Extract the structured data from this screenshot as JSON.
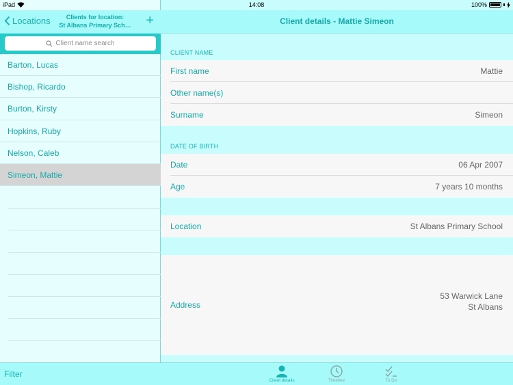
{
  "status_bar": {
    "device": "iPad",
    "time": "14:08",
    "battery": "100%"
  },
  "left_header": {
    "back_label": "Locations",
    "title_line1": "Clients for location:",
    "title_line2": "St Albans Primary Sch…",
    "add_label": "+"
  },
  "search": {
    "placeholder": "Client name search"
  },
  "clients": [
    {
      "name": "Barton, Lucas"
    },
    {
      "name": "Bishop, Ricardo"
    },
    {
      "name": "Burton, Kirsty"
    },
    {
      "name": "Hopkins, Ruby"
    },
    {
      "name": "Nelson, Caleb"
    },
    {
      "name": "Simeon, Mattie"
    }
  ],
  "left_footer": {
    "filter_label": "Filter"
  },
  "detail": {
    "title": "Client details - Mattie Simeon",
    "section_name": "CLIENT NAME",
    "first_name_label": "First name",
    "first_name_value": "Mattie",
    "other_names_label": "Other name(s)",
    "other_names_value": "",
    "surname_label": "Surname",
    "surname_value": "Simeon",
    "section_dob": "DATE OF BIRTH",
    "date_label": "Date",
    "date_value": "06 Apr 2007",
    "age_label": "Age",
    "age_value": "7 years 10 months",
    "location_label": "Location",
    "location_value": "St Albans Primary School",
    "address_label": "Address",
    "address_line1": "53 Warwick Lane",
    "address_line2": "St Albans"
  },
  "tabs": [
    {
      "label": "Client details",
      "icon": "person-icon",
      "active": true
    },
    {
      "label": "Timeline",
      "icon": "clock-icon",
      "active": false
    },
    {
      "label": "To Do",
      "icon": "checklist-icon",
      "active": false
    }
  ],
  "colors": {
    "accent": "#1ab2b2",
    "header": "#a7fafa",
    "search_bar": "#28c9c9",
    "selected_row": "#d4d4d4"
  }
}
